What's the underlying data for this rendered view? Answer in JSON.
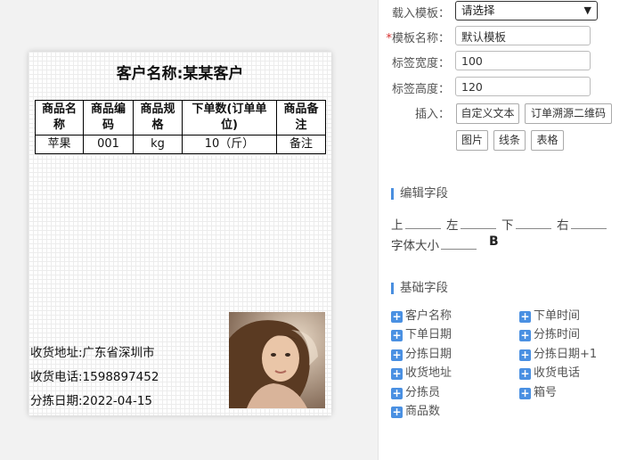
{
  "label": {
    "title": "客户名称:某某客户",
    "table_headers": [
      "商品名称",
      "商品编码",
      "商品规格",
      "下单数(订单单位)",
      "商品备注"
    ],
    "table_rows": [
      [
        "苹果",
        "001",
        "kg",
        "10（斤）",
        "备注"
      ]
    ],
    "address": "收货地址:广东省深圳市",
    "phone": "收货电话:1598897452",
    "sort_date": "分拣日期:2022-04-15"
  },
  "form": {
    "template_label": "载入模板：",
    "template_value": "请选择",
    "name_label": "模板名称：",
    "name_value": "默认模板",
    "width_label": "标签宽度：",
    "width_value": "100",
    "height_label": "标签高度：",
    "height_value": "120",
    "insert_label": "插入：",
    "insert_buttons": [
      "自定义文本",
      "订单溯源二维码",
      "图片",
      "线条",
      "表格"
    ]
  },
  "edit_section": {
    "title": "编辑字段",
    "top": "上",
    "left": "左",
    "bottom": "下",
    "right": "右",
    "font_size": "字体大小",
    "bold": "B"
  },
  "basic_section": {
    "title": "基础字段",
    "fields": [
      "客户名称",
      "下单时间",
      "下单日期",
      "分拣时间",
      "分拣日期",
      "分拣日期+1",
      "收货地址",
      "收货电话",
      "分拣员",
      "箱号",
      "商品数"
    ]
  },
  "colors": {
    "accent": "#4a90e2",
    "required": "#d62d2d"
  },
  "icons": {
    "add_field": "plus-icon",
    "select": "chevron-down-icon"
  }
}
